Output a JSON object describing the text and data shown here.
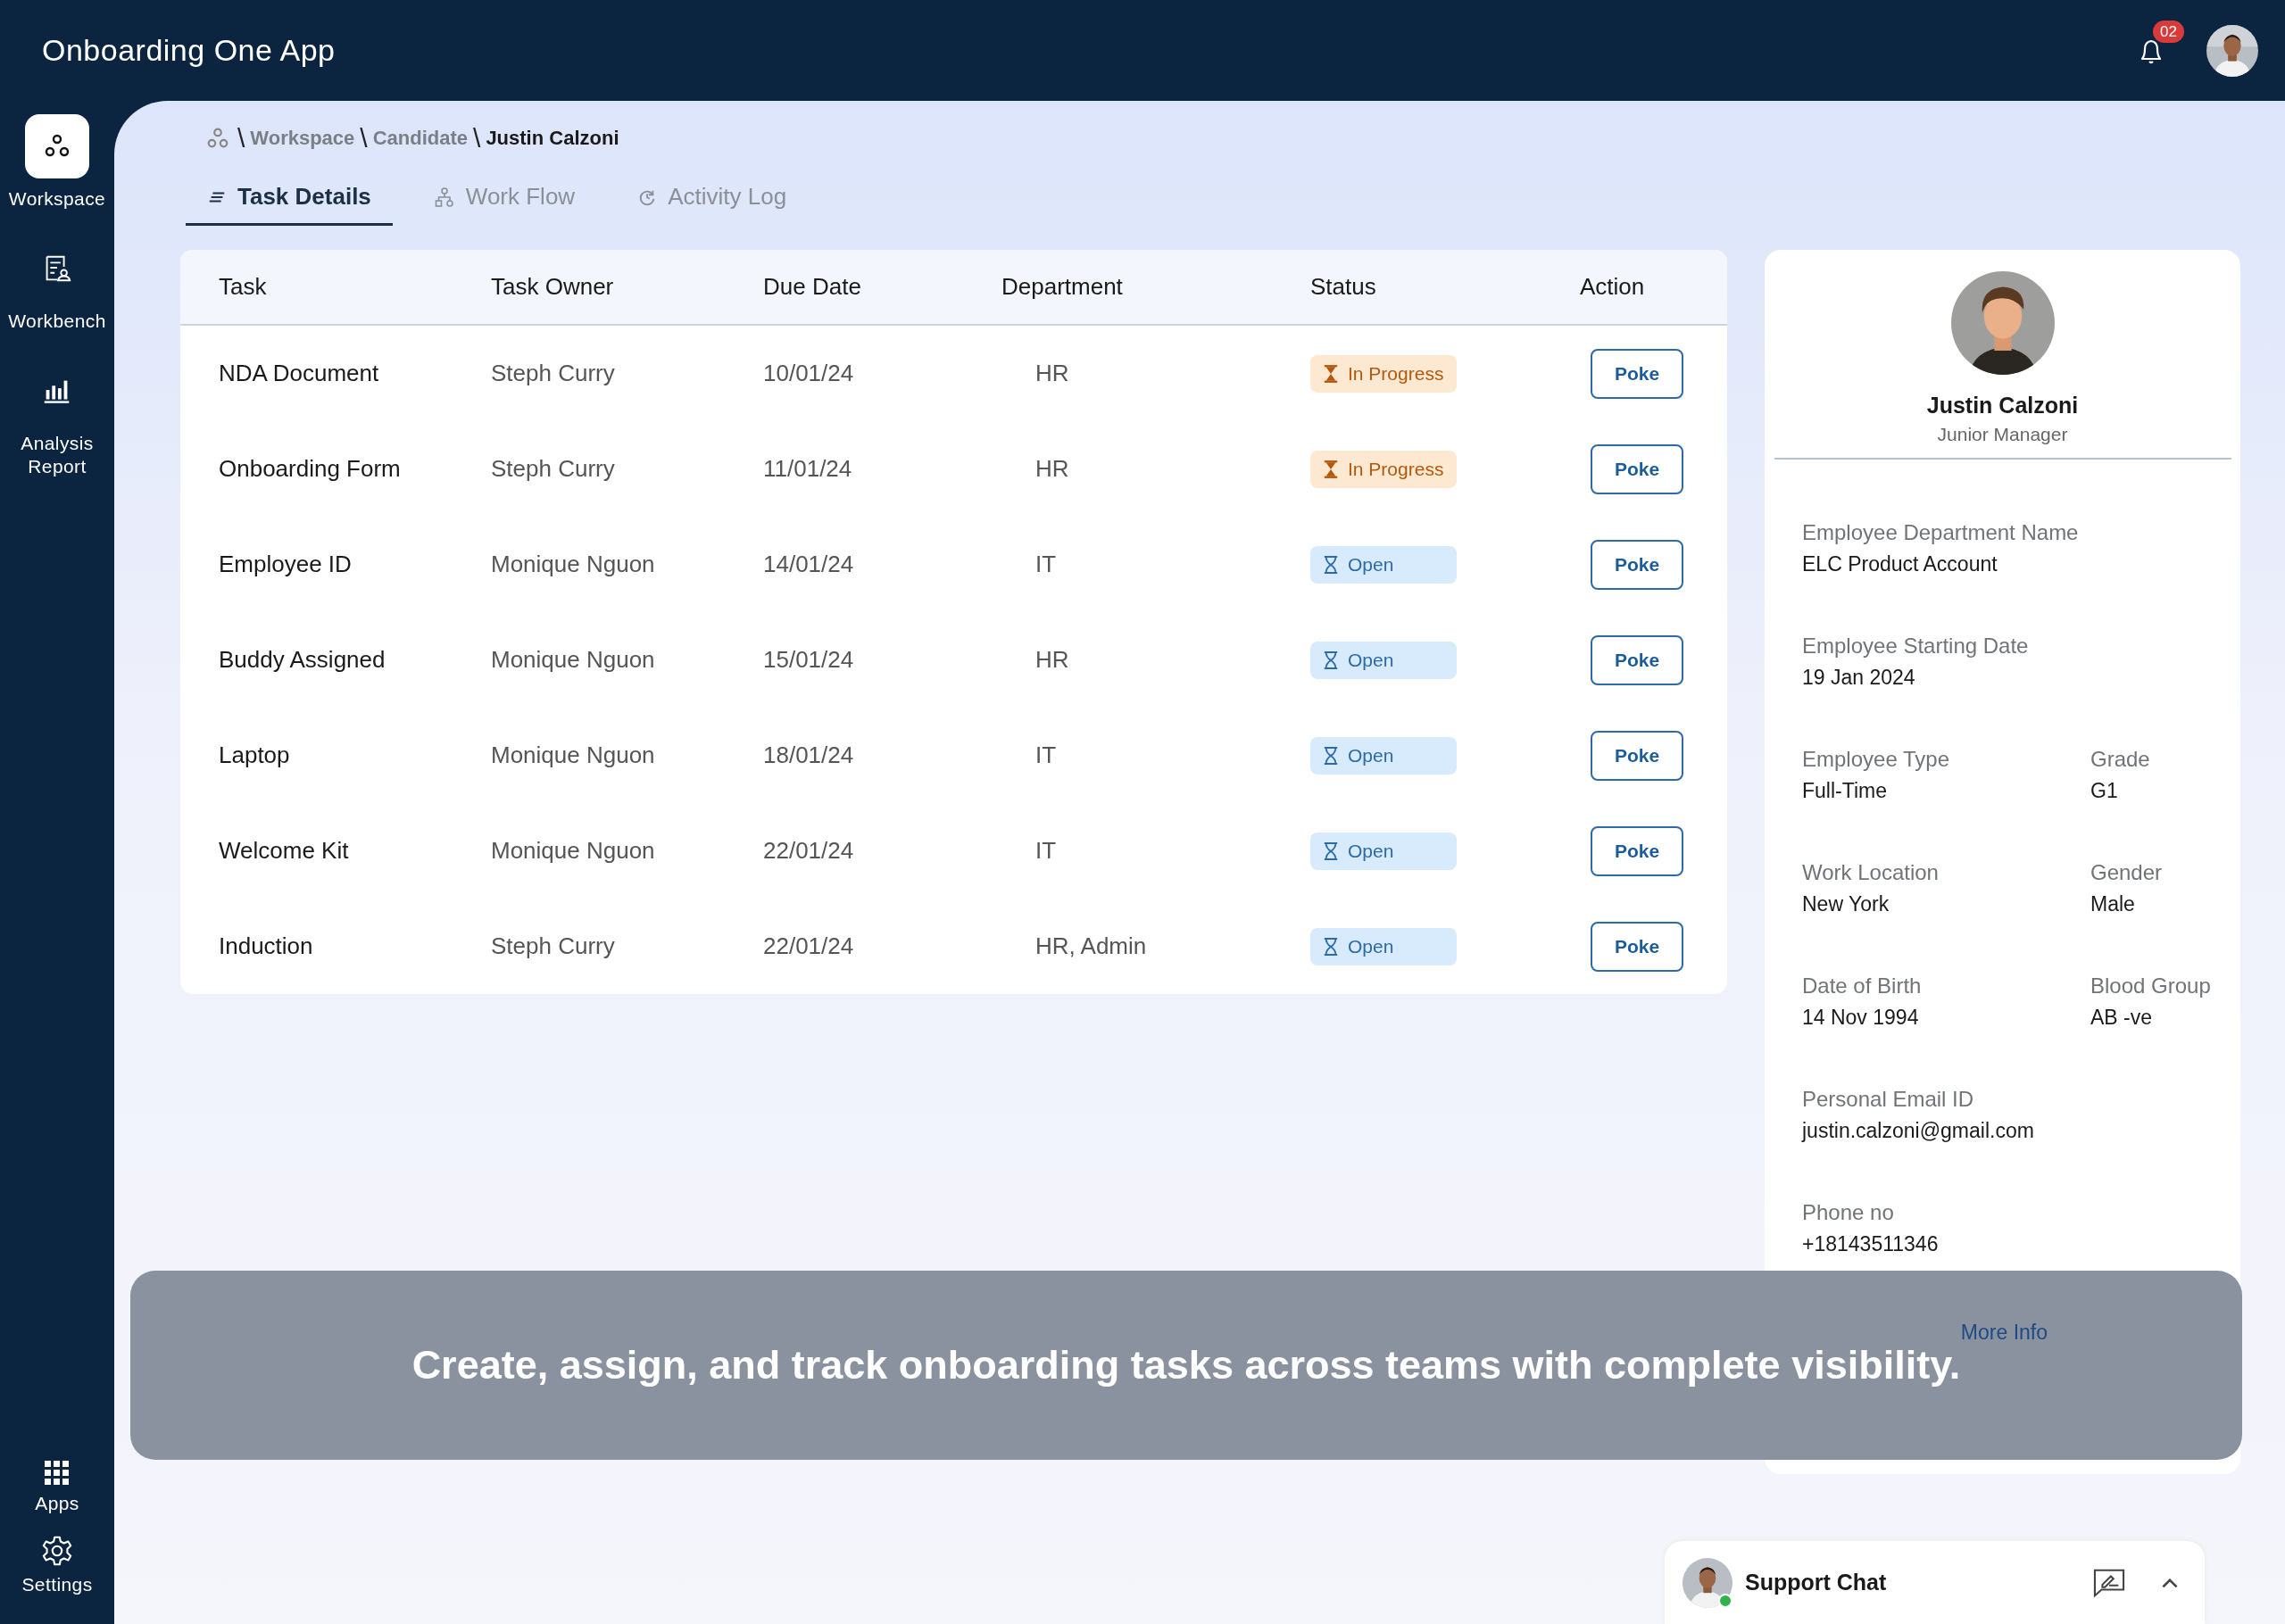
{
  "app": {
    "title": "Onboarding One App",
    "notification_count": "02"
  },
  "sidebar": {
    "items": [
      {
        "label": "Workspace",
        "kind": "workspace",
        "selected": true
      },
      {
        "label": "Workbench",
        "kind": "workbench",
        "selected": false
      },
      {
        "label": "Analysis Report",
        "kind": "analysis",
        "selected": false
      }
    ],
    "bottom_items": [
      {
        "label": "Apps",
        "kind": "apps"
      },
      {
        "label": "Settings",
        "kind": "settings"
      }
    ]
  },
  "breadcrumb": [
    {
      "separator": "\\",
      "label": "Workspace"
    },
    {
      "separator": "\\",
      "label": "Candidate"
    },
    {
      "separator": "\\",
      "label": "Justin Calzoni"
    }
  ],
  "tabs": [
    {
      "label": "Task Details",
      "kind": "list",
      "selected": true
    },
    {
      "label": "Work Flow",
      "kind": "flow",
      "selected": false
    },
    {
      "label": "Activity Log",
      "kind": "history",
      "selected": false
    }
  ],
  "table": {
    "columns": [
      "Task",
      "Task Owner",
      "Due Date",
      "Department",
      "Status",
      "Action"
    ],
    "rows": [
      {
        "task": "NDA Document",
        "owner": "Steph Curry",
        "due_date": "10/01/24",
        "department": "HR",
        "status": {
          "label": "In Progress",
          "kind": "in_progress"
        },
        "action": "Poke"
      },
      {
        "task": "Onboarding Form",
        "owner": "Steph Curry",
        "due_date": "11/01/24",
        "department": "HR",
        "status": {
          "label": "In Progress",
          "kind": "in_progress"
        },
        "action": "Poke"
      },
      {
        "task": "Employee ID",
        "owner": "Monique Nguon",
        "due_date": "14/01/24",
        "department": "IT",
        "status": {
          "label": "Open",
          "kind": "open"
        },
        "action": "Poke"
      },
      {
        "task": "Buddy Assigned",
        "owner": "Monique Nguon",
        "due_date": "15/01/24",
        "department": "HR",
        "status": {
          "label": "Open",
          "kind": "open"
        },
        "action": "Poke"
      },
      {
        "task": "Laptop",
        "owner": "Monique Nguon",
        "due_date": "18/01/24",
        "department": "IT",
        "status": {
          "label": "Open",
          "kind": "open"
        },
        "action": "Poke"
      },
      {
        "task": "Welcome Kit",
        "owner": "Monique Nguon",
        "due_date": "22/01/24",
        "department": "IT",
        "status": {
          "label": "Open",
          "kind": "open"
        },
        "action": "Poke"
      },
      {
        "task": "Induction",
        "owner": "Steph Curry",
        "due_date": "22/01/24",
        "department": "HR, Admin",
        "status": {
          "label": "Open",
          "kind": "open"
        },
        "action": "Poke"
      }
    ]
  },
  "profile": {
    "name": "Justin Calzoni",
    "role": "Junior Manager",
    "rows": [
      {
        "fields": [
          {
            "label": "Employee Department Name",
            "value": "ELC Product Account"
          }
        ]
      },
      {
        "fields": [
          {
            "label": "Employee Starting Date",
            "value": "19 Jan 2024"
          }
        ]
      },
      {
        "fields": [
          {
            "label": "Employee Type",
            "value": "Full-Time"
          },
          {
            "label": "Grade",
            "value": "G1"
          }
        ]
      },
      {
        "fields": [
          {
            "label": "Work Location",
            "value": "New York"
          },
          {
            "label": "Gender",
            "value": "Male"
          }
        ]
      },
      {
        "fields": [
          {
            "label": "Date of Birth",
            "value": "14 Nov 1994"
          },
          {
            "label": "Blood Group",
            "value": "AB -ve"
          }
        ]
      },
      {
        "fields": [
          {
            "label": "Personal Email ID",
            "value": "justin.calzoni@gmail.com"
          }
        ]
      },
      {
        "fields": [
          {
            "label": "Phone no",
            "value": "+18143511346"
          }
        ]
      }
    ]
  },
  "banner": {
    "text": "Create, assign, and track onboarding tasks across teams with complete visibility.",
    "link": "More Info"
  },
  "support_chat": {
    "title": "Support Chat",
    "online": true
  }
}
